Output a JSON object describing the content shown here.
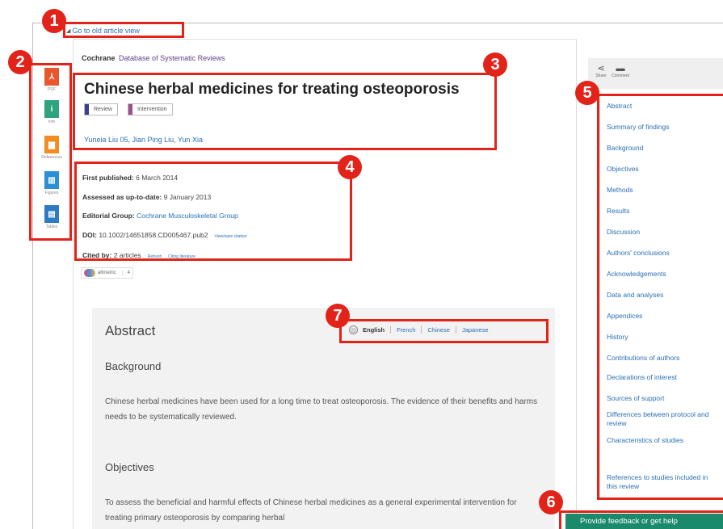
{
  "old_view_link": "Go to old article view",
  "brand": {
    "name": "Cochrane",
    "db": "Database of Systematic Reviews"
  },
  "left_bar": [
    {
      "label": "PDF",
      "icon": "pdf-icon",
      "color": "#e8562e"
    },
    {
      "label": "Info",
      "icon": "info-icon",
      "color": "#2fa37d"
    },
    {
      "label": "References",
      "icon": "references-icon",
      "color": "#f28c1e"
    },
    {
      "label": "Figures",
      "icon": "figures-icon",
      "color": "#2b8fd6"
    },
    {
      "label": "Tables",
      "icon": "tables-icon",
      "color": "#2e7bc4"
    }
  ],
  "article": {
    "title": "Chinese herbal medicines for treating osteoporosis",
    "tags": [
      {
        "label": "Review",
        "color": "#3a3f8f"
      },
      {
        "label": "Intervention",
        "color": "#9b4f8f"
      }
    ],
    "authors": "Yuneia Liu 05, Jian Ping Liu, Yun Xia"
  },
  "meta": {
    "first_published_key": "First published:",
    "first_published_val": "6 March 2014",
    "assessed_key": "Assessed as up-to-date:",
    "assessed_val": "9 January 2013",
    "group_key": "Editorial Group:",
    "group_val": "Cochrane Musculoskeletal Group",
    "doi_key": "DOI:",
    "doi_val": "10.1002/14651858.CD005467.pub2",
    "doi_extra": "View/save citation",
    "cited_key": "Cited by:",
    "cited_val": "2 articles",
    "cited_refresh": "Refresh",
    "cited_literature": "Citing literature"
  },
  "altmetric": {
    "label": "altmetric",
    "count": "4"
  },
  "abstract": {
    "heading": "Abstract",
    "languages": [
      "English",
      "French",
      "Chinese",
      "Japanese"
    ],
    "background_h": "Background",
    "background_p": "Chinese herbal medicines have been used for a long time to treat osteoporosis. The evidence of their benefits and harms needs to be systematically reviewed.",
    "objectives_h": "Objectives",
    "objectives_p": "To assess the beneficial and harmful effects of Chinese herbal medicines as a general experimental intervention for treating primary osteoporosis by comparing herbal"
  },
  "share_bar": [
    {
      "label": "Share",
      "icon": "share-icon"
    },
    {
      "label": "Comment",
      "icon": "comment-icon"
    }
  ],
  "toc": [
    "Abstract",
    "Summary of findings",
    "Background",
    "Objectives",
    "Methods",
    "Results",
    "Discussion",
    "Authors' conclusions",
    "Acknowledgements",
    "Data and analyses",
    "Appendices",
    "History",
    "Contributions of authors",
    "Declarations of interest",
    "Sources of support",
    "Differences between protocol and review",
    "Characteristics of studies",
    "References to studies included in this review"
  ],
  "feedback": "Provide feedback or get help",
  "badges": [
    "1",
    "2",
    "3",
    "4",
    "5",
    "6",
    "7"
  ],
  "highlight_color": "#e2231a"
}
